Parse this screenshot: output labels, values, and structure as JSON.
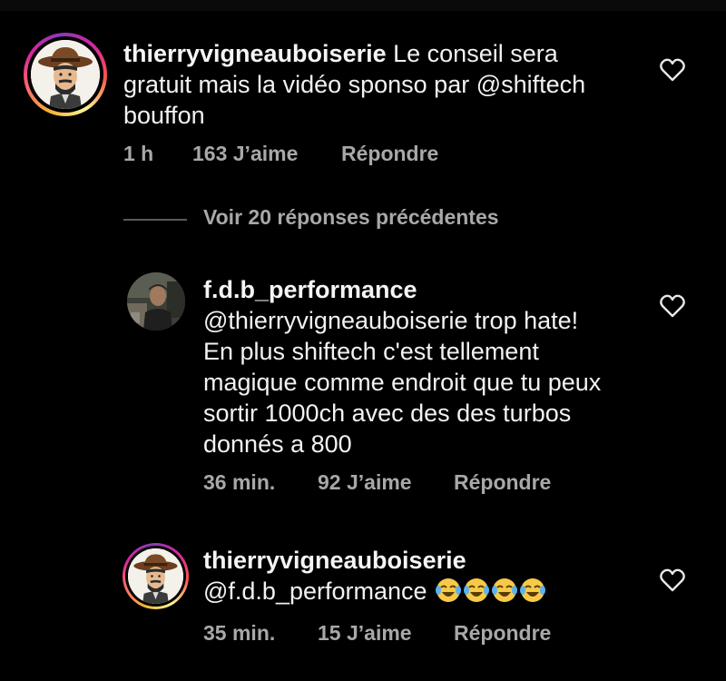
{
  "comments": [
    {
      "username": "thierryvigneauboiserie",
      "text_lines": [
        "Le conseil sera",
        "gratuit mais la vidéo sponso par @shiftech",
        "bouffon"
      ],
      "time": "1 h",
      "likes": "163 J’aime",
      "reply_label": "Répondre",
      "avatar": "cowboy-avatar",
      "has_story_ring": true
    },
    {
      "username": "f.d.b_performance",
      "text_lines": [
        "@thierryvigneauboiserie trop hate!",
        "En plus shiftech c'est tellement",
        "magique comme endroit que tu peux",
        "sortir 1000ch avec des des turbos",
        "donnés a 800"
      ],
      "time": "36 min.",
      "likes": "92 J’aime",
      "reply_label": "Répondre",
      "avatar": "photo-avatar",
      "has_story_ring": false
    },
    {
      "username": "thierryvigneauboiserie",
      "text_lines": [
        "@f.d.b_performance"
      ],
      "emojis": [
        "face-with-tears-of-joy",
        "face-with-tears-of-joy",
        "face-with-tears-of-joy",
        "face-with-tears-of-joy"
      ],
      "time": "35 min.",
      "likes": "15 J’aime",
      "reply_label": "Répondre",
      "avatar": "cowboy-avatar",
      "has_story_ring": true
    }
  ],
  "replies_toggle": {
    "label": "Voir 20 réponses précédentes"
  },
  "icons": {
    "like": "heart-outline-icon"
  },
  "colors": {
    "background": "#000000",
    "text": "#f2f2f2",
    "secondary_text": "#a8a8a8"
  }
}
